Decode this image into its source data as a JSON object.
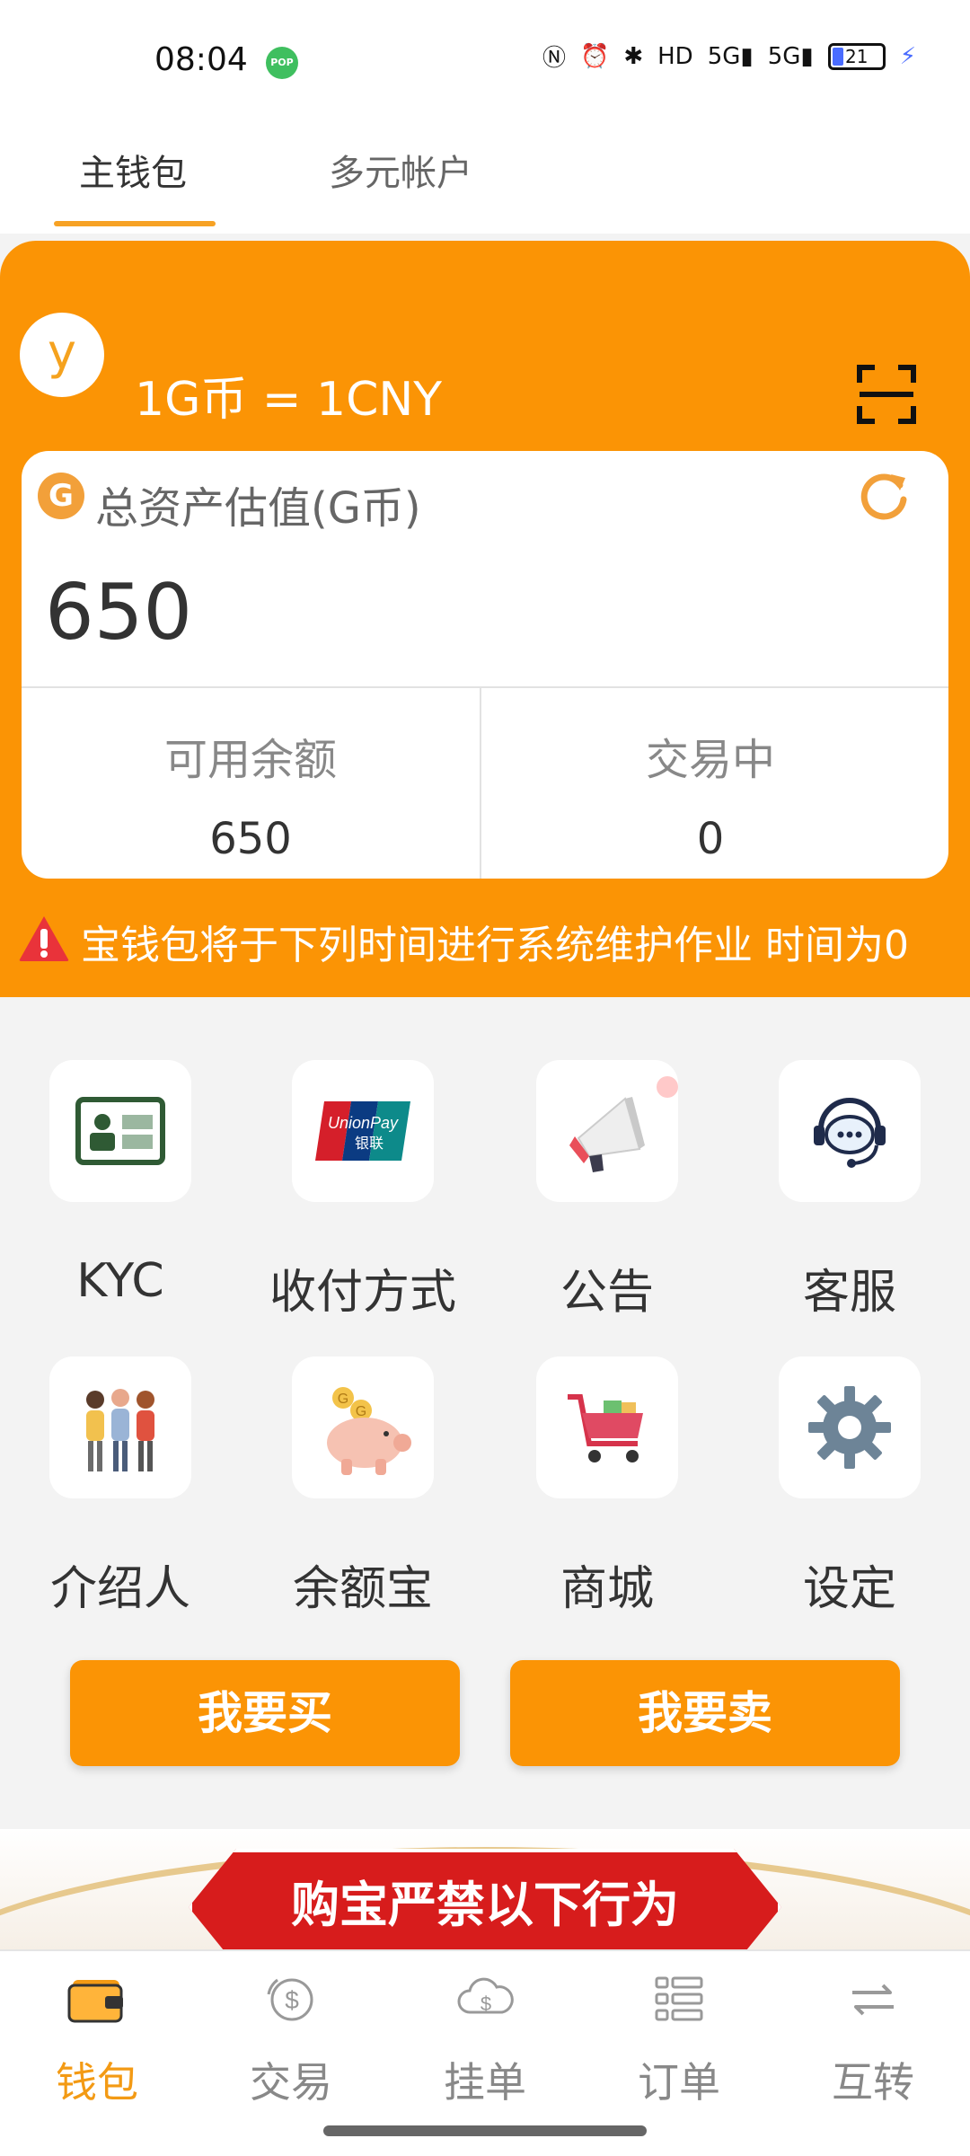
{
  "status_bar": {
    "time": "08:04",
    "pop_badge": "POP",
    "battery": "21",
    "signal_1": "5G",
    "signal_2": "5G",
    "hd": "HD"
  },
  "tabs": [
    {
      "label": "主钱包",
      "active": true
    },
    {
      "label": "多元帐户",
      "active": false
    }
  ],
  "wallet": {
    "avatar_letter": "y",
    "rate": "1G币 = 1CNY",
    "asset_label": "总资产估值(G币)",
    "asset_value": "650",
    "available_label": "可用余额",
    "available_value": "650",
    "trading_label": "交易中",
    "trading_value": "0",
    "coin_glyph": "G",
    "notice": "宝钱包将于下列时间进行系统维护作业     时间为0"
  },
  "grid": [
    {
      "label": "KYC",
      "icon": "id-card-icon"
    },
    {
      "label": "收付方式",
      "icon": "unionpay-icon"
    },
    {
      "label": "公告",
      "icon": "megaphone-icon"
    },
    {
      "label": "客服",
      "icon": "headset-chat-icon"
    },
    {
      "label": "介绍人",
      "icon": "people-group-icon"
    },
    {
      "label": "余额宝",
      "icon": "piggy-bank-icon"
    },
    {
      "label": "商城",
      "icon": "shopping-cart-icon"
    },
    {
      "label": "设定",
      "icon": "gear-icon"
    }
  ],
  "actions": {
    "buy": "我要买",
    "sell": "我要卖"
  },
  "banner": {
    "text": "购宝严禁以下行为"
  },
  "bottom_nav": [
    {
      "label": "钱包",
      "icon": "wallet-icon",
      "active": true
    },
    {
      "label": "交易",
      "icon": "exchange-coin-icon",
      "active": false
    },
    {
      "label": "挂单",
      "icon": "cloud-dollar-icon",
      "active": false
    },
    {
      "label": "订单",
      "icon": "list-icon",
      "active": false
    },
    {
      "label": "互转",
      "icon": "transfer-arrows-icon",
      "active": false
    }
  ],
  "colors": {
    "primary": "#fb9405",
    "active_nav": "#f39a14",
    "banner_red": "#d71c1c"
  }
}
